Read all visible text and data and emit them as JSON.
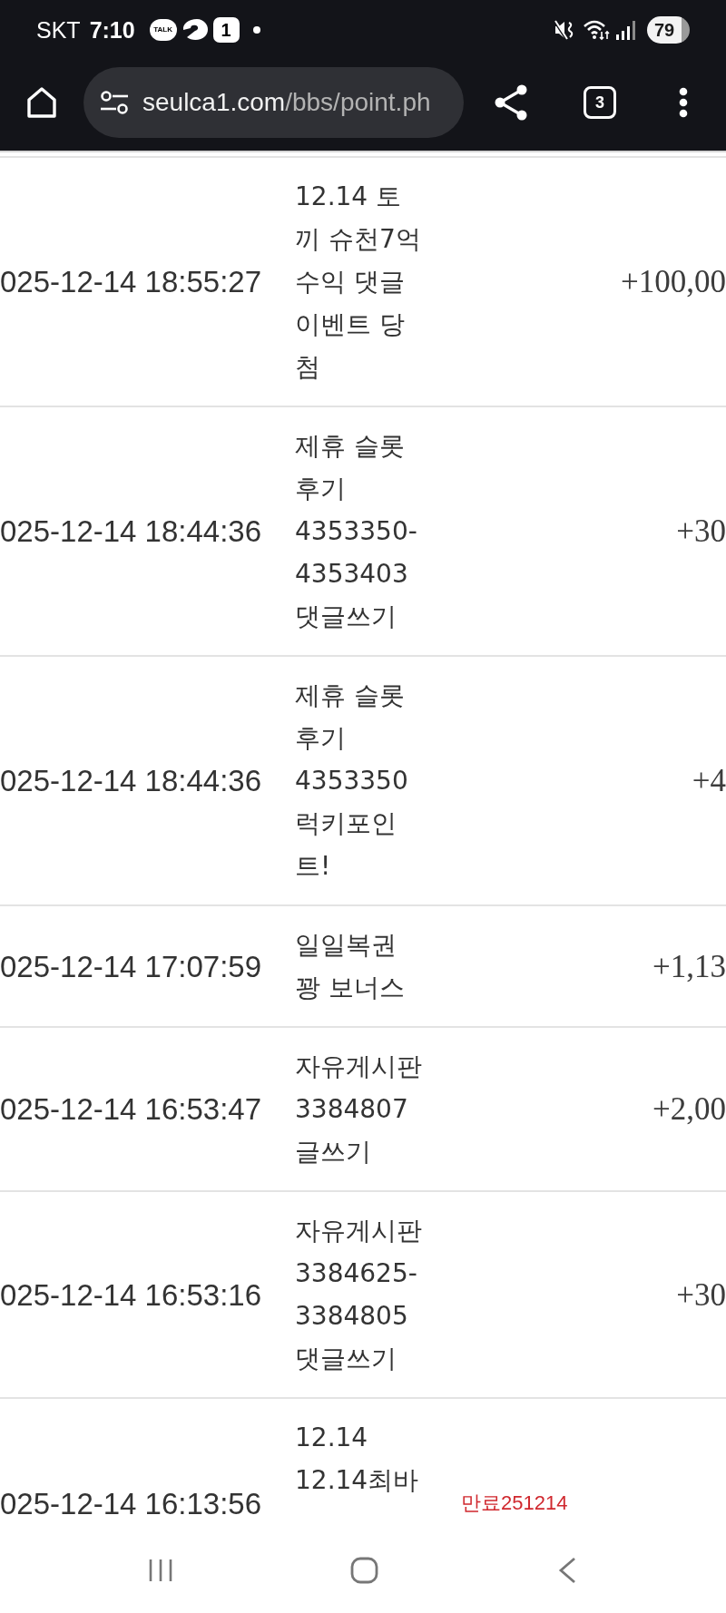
{
  "status_bar": {
    "carrier": "SKT",
    "time": "7:10",
    "notifications": [
      {
        "kind": "chat",
        "label": "TALK"
      },
      {
        "kind": "app"
      },
      {
        "kind": "count",
        "label": "1"
      },
      {
        "kind": "dot"
      }
    ],
    "battery": "79"
  },
  "toolbar": {
    "url_domain": "seulca1.com",
    "url_path": "/bbs/point.ph",
    "tab_count": "3"
  },
  "table": {
    "rows": [
      {
        "column_1": "025-12-14 18:55:27",
        "column_2": "12.14 토끼 슈천7억 수익 댓글 이벤트 당첨",
        "column_4": "+100,00"
      },
      {
        "column_1": "025-12-14 18:44:36",
        "column_2": "제휴 슬롯 후기 4353350-4353403 댓글쓰기",
        "column_4": "+30"
      },
      {
        "column_1": "025-12-14 18:44:36",
        "column_2": "제휴 슬롯 후기 4353350 럭키포인트!",
        "column_4": "+4"
      },
      {
        "column_1": "025-12-14 17:07:59",
        "column_2": "일일복권 꽝 보너스",
        "column_4": "+1,13"
      },
      {
        "column_1": "025-12-14 16:53:47",
        "column_2": "자유게시판 3384807 글쓰기",
        "column_4": "+2,00"
      },
      {
        "column_1": "025-12-14 16:53:16",
        "column_2": "자유게시판 3384625-3384805 댓글쓰기",
        "column_4": "+30"
      },
      {
        "column_1": "025-12-14 16:13:56",
        "column_2": "12.14 12.14최바",
        "column_3": "만료251214"
      }
    ]
  }
}
